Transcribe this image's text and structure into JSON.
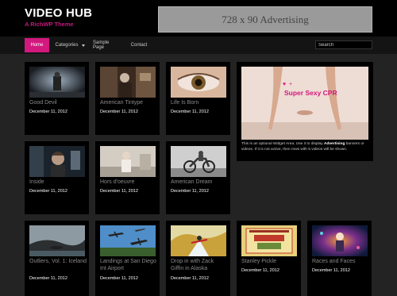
{
  "header": {
    "title": "VIDEO HUB",
    "tagline": "A RichWP Theme",
    "ad_text": "728 x 90 Advertising"
  },
  "nav": {
    "items": [
      {
        "label": "Home",
        "active": true
      },
      {
        "label": "Categories",
        "has_dropdown": true
      },
      {
        "label": "Sample Page"
      },
      {
        "label": "Contact"
      }
    ],
    "search_value": "Search"
  },
  "widget": {
    "image_text": "Super Sexy CPR",
    "text_before": "This is an optional Widget Area. Use it to display ",
    "text_bold": "Advertising",
    "text_after": " banners or videos. If it is not active, then rows with 5 videos will be shown."
  },
  "videos": [
    {
      "title": "Good Devil",
      "date": "December 11, 2012"
    },
    {
      "title": "American Tintype",
      "date": "December 11, 2012"
    },
    {
      "title": "Life Is Born",
      "date": "December 11, 2012"
    },
    {
      "title": "Inside",
      "date": "December 11, 2012"
    },
    {
      "title": "Hors d'oeuvre",
      "date": "December 11, 2012"
    },
    {
      "title": "American Dream",
      "date": "December 11, 2012"
    },
    {
      "title": "Outliers, Vol. 1: Iceland",
      "date": "December 11, 2012"
    },
    {
      "title": "Landings at San Diego Int Airport",
      "date": "December 11, 2012"
    },
    {
      "title": "Drop in with Zack Giffin in Alaska",
      "date": "December 11, 2012"
    },
    {
      "title": "Stanley Pickle",
      "date": "December 11, 2012"
    },
    {
      "title": "Races and Faces",
      "date": "December 11, 2012"
    }
  ],
  "colors": {
    "accent": "#d3187e",
    "background": "#232323",
    "card": "#000000"
  }
}
